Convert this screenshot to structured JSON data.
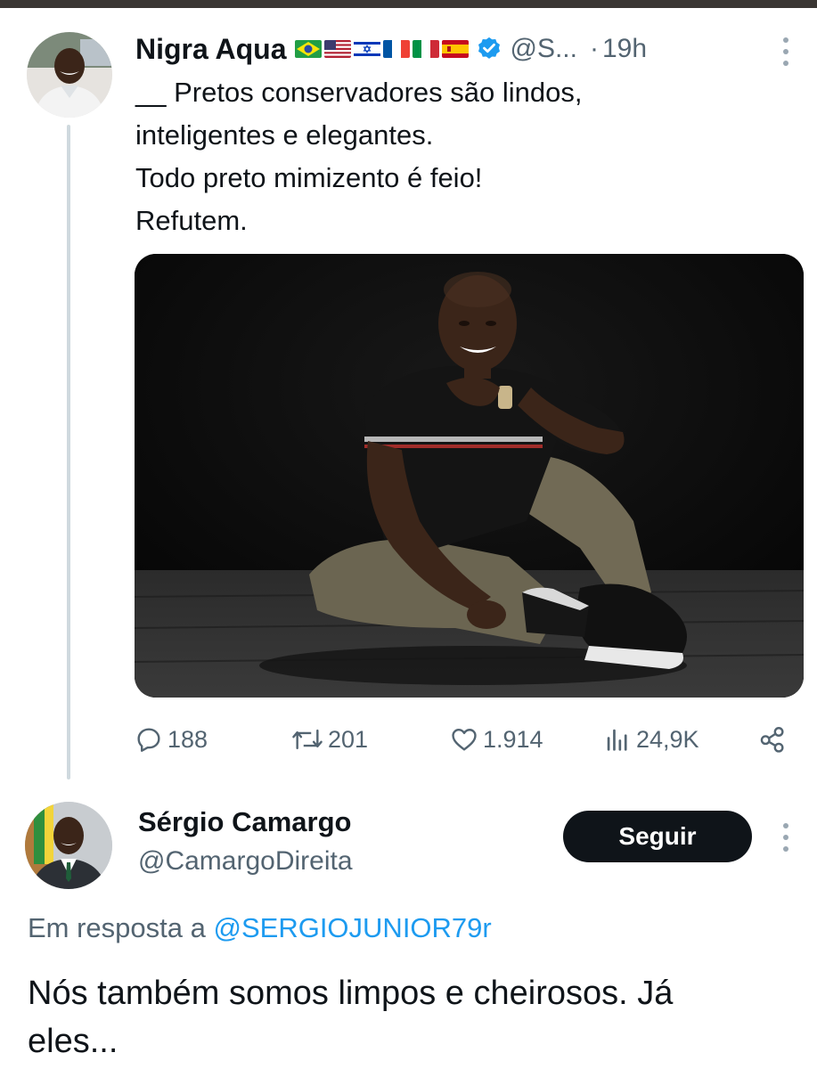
{
  "tweet1": {
    "author_name": "Nigra Aqua",
    "flags": [
      "brazil-flag",
      "usa-flag",
      "israel-flag",
      "france-flag",
      "italy-flag",
      "spain-flag"
    ],
    "handle": "@S...",
    "separator": "·",
    "time": "19h",
    "text_lines": [
      "__ Pretos conservadores são lindos,",
      "inteligentes e elegantes.",
      "Todo preto mimizento é feio!",
      "Refutem."
    ],
    "stats": {
      "replies": "188",
      "reposts": "201",
      "likes": "1.914",
      "views": "24,9K"
    }
  },
  "tweet2": {
    "author_name": "Sérgio Camargo",
    "handle": "@CamargoDireita",
    "follow_label": "Seguir",
    "reply_prefix": "Em resposta a",
    "reply_handle": "@SERGIOJUNIOR79r",
    "text_lines": [
      "Nós também somos limpos e cheirosos. Já",
      "eles..."
    ]
  },
  "colors": {
    "text": "#0f1419",
    "secondary": "#536471",
    "link": "#1d9bf0",
    "verified": "#1d9bf0",
    "button": "#0f1419"
  }
}
